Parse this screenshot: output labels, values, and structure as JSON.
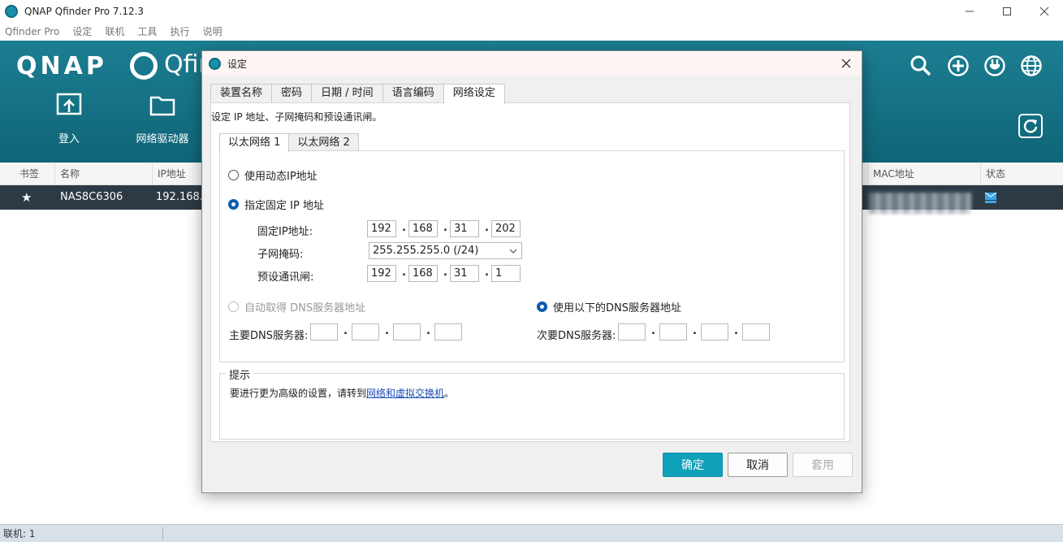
{
  "window": {
    "title": "QNAP Qfinder Pro 7.12.3"
  },
  "menu": [
    "Qfinder Pro",
    "设定",
    "联机",
    "工具",
    "执行",
    "说明"
  ],
  "header": {
    "logo_text": "QNAP",
    "product_partial": "Qfin",
    "buttons": [
      {
        "label": "登入",
        "icon": "login-icon"
      },
      {
        "label": "网络驱动器",
        "icon": "folder-icon"
      }
    ],
    "right_icons": [
      "search-icon",
      "add-icon",
      "plug-icon",
      "globe-icon"
    ],
    "refresh_icon": "refresh-icon"
  },
  "table": {
    "columns": [
      "书签",
      "名称",
      "IP地址",
      "MAC地址",
      "状态"
    ],
    "row": {
      "bookmark": "★",
      "name": "NAS8C6306",
      "ip": "192.168."
    }
  },
  "status_bar": {
    "text": "联机: 1"
  },
  "dialog": {
    "title": "设定",
    "tabs": [
      "装置名称",
      "密码",
      "日期 / 时间",
      "语言编码",
      "网络设定"
    ],
    "active_tab": 4,
    "description": "设定 IP 地址、子网掩码和预设通讯闸。",
    "subtabs": [
      "以太网络 1",
      "以太网络 2"
    ],
    "dhcp_label": "使用动态IP地址",
    "static_label": "指定固定 IP 地址",
    "fixed_ip_label": "固定IP地址:",
    "fixed_ip": [
      "192",
      "168",
      "31",
      "202"
    ],
    "subnet_label": "子网掩码:",
    "subnet_value": "255.255.255.0 (/24)",
    "gateway_label": "预设通讯闸:",
    "gateway": [
      "192",
      "168",
      "31",
      "1"
    ],
    "auto_dns_label": "自动取得 DNS服务器地址",
    "manual_dns_label": "使用以下的DNS服务器地址",
    "primary_dns_label": "主要DNS服务器:",
    "secondary_dns_label": "次要DNS服务器:",
    "hint_title": "提示",
    "hint_prefix": "要进行更为高级的设置，请转到",
    "hint_link": "网络和虚拟交换机",
    "hint_suffix": "。",
    "ok": "确定",
    "cancel": "取消",
    "apply": "套用"
  }
}
